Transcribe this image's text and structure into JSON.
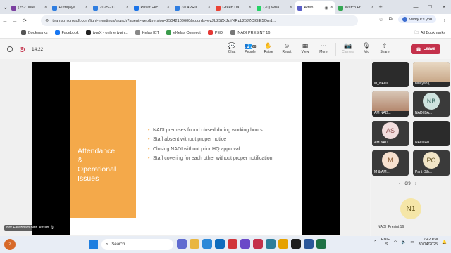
{
  "browser": {
    "tabs": [
      {
        "label": "(252 unre",
        "color": "#7b3fa0"
      },
      {
        "label": "Putrajaya",
        "color": "#2e7de0"
      },
      {
        "label": "2025 - C",
        "color": "#2e7de0"
      },
      {
        "label": "Pusat Ekc",
        "color": "#1a73e8"
      },
      {
        "label": "30 APRIL",
        "color": "#2e7de0"
      },
      {
        "label": "Green Da",
        "color": "#ea4335"
      },
      {
        "label": "(70) Wha",
        "color": "#25d366"
      },
      {
        "label": "Atten",
        "color": "#5b5fc7"
      },
      {
        "label": "Watch Fr",
        "color": "#34a853"
      }
    ],
    "new_tab": "+",
    "url": "teams.microsoft.com/light-meetings/launch?agent=web&version=25042109600&coords=eyJjb25ZXJzYXRpb25JZCI6IjE5Om1...",
    "verify_label": "Verify it's you",
    "bookmarks": [
      {
        "label": "Bookmarks",
        "color": "#555555"
      },
      {
        "label": "Facebook",
        "color": "#1877f2"
      },
      {
        "label": "typrX - online typin...",
        "color": "#222222"
      },
      {
        "label": "Kelas ICT",
        "color": "#888888"
      },
      {
        "label": "eKelas Connect",
        "color": "#3a9b4b"
      },
      {
        "label": "PEDi",
        "color": "#e53935"
      },
      {
        "label": "NADI PRESINT 16",
        "color": "#777777"
      }
    ],
    "all_bookmarks": "All Bookmarks"
  },
  "meeting": {
    "timer": "14:22",
    "controls": [
      {
        "label": "Chat",
        "icon": "chat-icon",
        "glyph": "💬"
      },
      {
        "label": "People",
        "icon": "people-icon",
        "glyph": "👥",
        "count": "68"
      },
      {
        "label": "Raise",
        "icon": "raise-hand-icon",
        "glyph": "✋"
      },
      {
        "label": "React",
        "icon": "react-icon",
        "glyph": "☺"
      },
      {
        "label": "View",
        "icon": "view-icon",
        "glyph": "▦"
      },
      {
        "label": "More",
        "icon": "more-icon",
        "glyph": "⋯"
      },
      {
        "label": "Camera",
        "icon": "camera-icon",
        "glyph": "📷"
      },
      {
        "label": "Mic",
        "icon": "mic-icon",
        "glyph": "🎙"
      },
      {
        "label": "Share",
        "icon": "share-icon",
        "glyph": "⇧"
      }
    ],
    "leave_label": "Leave"
  },
  "slide": {
    "title_lines": [
      "Attendance",
      "&",
      "Operational",
      "Issues"
    ],
    "bullets": [
      "NADI premises found closed during working hours",
      "Staff absent without proper notice",
      "Closing NADI without prior HQ approval",
      "Staff covering for each other without proper notification"
    ],
    "accent_color": "#f4a94a"
  },
  "presenter_name": "Nor Faraziham Binti Ikhsan",
  "participants": [
    {
      "name": "M_NADI ...",
      "type": "dark"
    },
    {
      "name": "hidayah (...",
      "type": "photo"
    },
    {
      "name": "AM NAD...",
      "type": "photo"
    },
    {
      "name": "NADI BA...",
      "initials": "NB",
      "bg": "#cfe3df",
      "fg": "#3c6b63"
    },
    {
      "name": "AM NAD...",
      "initials": "AS",
      "bg": "#f2dede",
      "fg": "#8a4a4a"
    },
    {
      "name": "NADI Fel...",
      "type": "dark"
    },
    {
      "name": "M & AM...",
      "initials": "M",
      "bg": "#f7e1cf",
      "fg": "#8a5a32"
    },
    {
      "name": "Parit Oth...",
      "initials": "PO",
      "bg": "#f1e5c7",
      "fg": "#6b5a2a"
    }
  ],
  "pager": {
    "label": "6/9",
    "prev": "‹",
    "next": "›"
  },
  "featured_participant": {
    "initials": "N1",
    "name": "NADI_Presint 16"
  },
  "taskbar": {
    "weather_badge": "2",
    "search_placeholder": "Search",
    "lang_top": "ENG",
    "lang_bottom": "US",
    "time": "2:42 PM",
    "date": "30/04/2025"
  }
}
